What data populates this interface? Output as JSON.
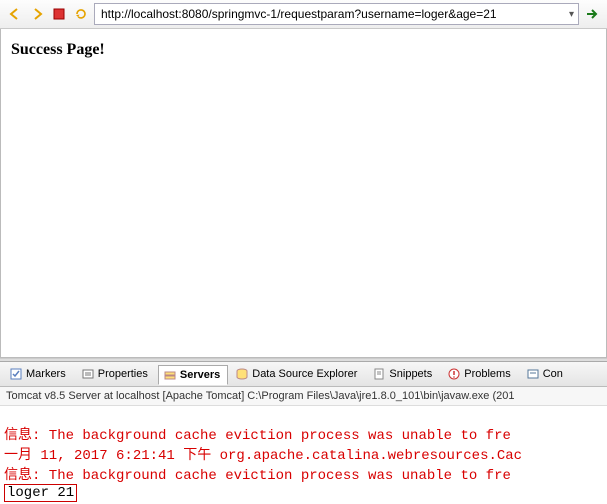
{
  "toolbar": {
    "url": "http://localhost:8080/springmvc-1/requestparam?username=loger&age=21"
  },
  "page": {
    "heading": "Success Page!"
  },
  "tabs": {
    "items": [
      {
        "label": "Markers"
      },
      {
        "label": "Properties"
      },
      {
        "label": "Servers"
      },
      {
        "label": "Data Source Explorer"
      },
      {
        "label": "Snippets"
      },
      {
        "label": "Problems"
      },
      {
        "label": "Con"
      }
    ],
    "active_index": 2
  },
  "console": {
    "header": "Tomcat v8.5 Server at localhost [Apache Tomcat] C:\\Program Files\\Java\\jre1.8.0_101\\bin\\javaw.exe (201",
    "lines": [
      {
        "cls": "red",
        "text": "信息: The background cache eviction process was unable to fre"
      },
      {
        "cls": "red",
        "text": "一月 11, 2017 6:21:41 下午 org.apache.catalina.webresources.Cac"
      },
      {
        "cls": "red",
        "text": "信息: The background cache eviction process was unable to fre"
      }
    ],
    "highlighted_output": "loger 21"
  }
}
